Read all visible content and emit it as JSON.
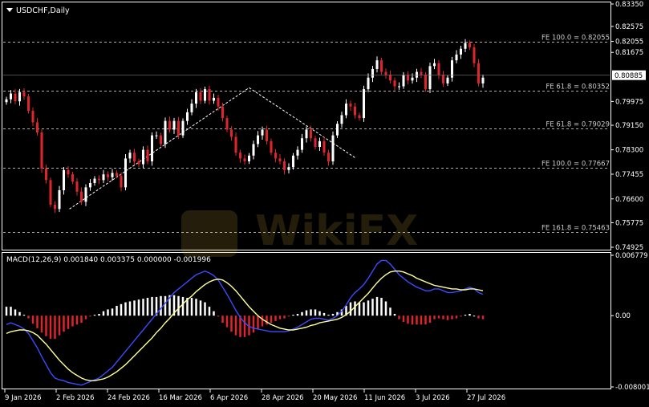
{
  "window": {
    "symbol_label": "USDCHF,Daily",
    "macd_label": "MACD(12,26,9) 0.001840 0.003375 0.000000 -0.001996",
    "watermark": "WikiFX"
  },
  "colors": {
    "background": "#000000",
    "frame": "#ffffff",
    "bull_candle": "#ffffff",
    "bear_candle": "#e0242e",
    "fib_line": "#cfcfcf",
    "macd_main": "#3b4bff",
    "macd_signal": "#ffff9a",
    "hist_pos": "#ffffff",
    "hist_neg": "#e0242e",
    "current_price_box": "#ffffff"
  },
  "chart_data": [
    {
      "type": "candlestick",
      "title": "USDCHF,Daily",
      "ylim": [
        0.74925,
        0.8335
      ],
      "price_scale": [
        "0.83350",
        "0.82575",
        "0.82055",
        "0.81675",
        "0.80885",
        "0.79975",
        "0.79150",
        "0.78300",
        "0.77455",
        "0.76600",
        "0.75775",
        "0.74925"
      ],
      "current_price": "0.80885",
      "fibo_levels": [
        {
          "label": "FE 100.0 = 0.82055",
          "value": 0.82055
        },
        {
          "label": "FE 61.8 = 0.80352",
          "value": 0.80352
        },
        {
          "label": "FE 61.8 = 0.79029",
          "value": 0.79029
        },
        {
          "label": "FE 100.0 = 0.77667",
          "value": 0.77667
        },
        {
          "label": "FE 161.8 = 0.75463",
          "value": 0.75463
        }
      ],
      "trend_points": [
        {
          "date": "2026-01-29",
          "price": 0.7625
        },
        {
          "date": "2026-03-27",
          "price": 0.8045
        },
        {
          "date": "2026-04-30",
          "price": 0.78
        }
      ],
      "x_labels": [
        "9 Jan 2026",
        "2 Feb 2026",
        "24 Feb 2026",
        "16 Mar 2026",
        "6 Apr 2026",
        "28 Apr 2026",
        "20 May 2026",
        "11 Jun 2026",
        "3 Jul 2026",
        "27 Jul 2026"
      ],
      "closes": [
        0.8005,
        0.8025,
        0.7998,
        0.803,
        0.8015,
        0.7965,
        0.7925,
        0.789,
        0.7765,
        0.7725,
        0.764,
        0.7625,
        0.769,
        0.776,
        0.7745,
        0.772,
        0.7685,
        0.765,
        0.77,
        0.7715,
        0.773,
        0.7725,
        0.7745,
        0.7735,
        0.775,
        0.774,
        0.77,
        0.78,
        0.782,
        0.779,
        0.778,
        0.783,
        0.779,
        0.788,
        0.788,
        0.785,
        0.793,
        0.79,
        0.793,
        0.788,
        0.793,
        0.796,
        0.799,
        0.803,
        0.8,
        0.804,
        0.8,
        0.801,
        0.798,
        0.794,
        0.79,
        0.7875,
        0.782,
        0.78,
        0.779,
        0.781,
        0.785,
        0.788,
        0.79,
        0.786,
        0.782,
        0.78,
        0.779,
        0.776,
        0.777,
        0.781,
        0.783,
        0.787,
        0.79,
        0.787,
        0.784,
        0.786,
        0.782,
        0.779,
        0.788,
        0.792,
        0.795,
        0.799,
        0.798,
        0.795,
        0.794,
        0.804,
        0.808,
        0.811,
        0.814,
        0.81,
        0.809,
        0.807,
        0.805,
        0.805,
        0.809,
        0.807,
        0.808,
        0.81,
        0.809,
        0.804,
        0.812,
        0.813,
        0.809,
        0.806,
        0.808,
        0.814,
        0.816,
        0.818,
        0.82,
        0.8185,
        0.813,
        0.806,
        0.808
      ],
      "macd_main": [
        -0.001,
        -0.0008,
        -0.001,
        -0.0012,
        -0.0015,
        -0.002,
        -0.0028,
        -0.0036,
        -0.0046,
        -0.0055,
        -0.0064,
        -0.007,
        -0.0072,
        -0.0073,
        -0.0075,
        -0.0076,
        -0.0077,
        -0.0078,
        -0.0076,
        -0.0074,
        -0.0072,
        -0.007,
        -0.0066,
        -0.0062,
        -0.0058,
        -0.0052,
        -0.0046,
        -0.004,
        -0.0034,
        -0.0028,
        -0.0022,
        -0.0016,
        -0.001,
        -0.0004,
        0.0002,
        0.0008,
        0.0014,
        0.002,
        0.0026,
        0.003,
        0.0034,
        0.0038,
        0.0042,
        0.0046,
        0.0048,
        0.005,
        0.0048,
        0.0045,
        0.004,
        0.0032,
        0.0024,
        0.0015,
        0.0006,
        -0.0002,
        -0.0008,
        -0.0012,
        -0.0014,
        -0.0015,
        -0.0016,
        -0.0017,
        -0.0018,
        -0.0018,
        -0.0018,
        -0.0018,
        -0.0017,
        -0.0015,
        -0.0013,
        -0.001,
        -0.0007,
        -0.0004,
        -0.0003,
        -0.0003,
        -0.0004,
        -0.0005,
        -0.0003,
        0.0,
        0.0005,
        0.0012,
        0.002,
        0.0026,
        0.003,
        0.0035,
        0.0042,
        0.005,
        0.0058,
        0.0062,
        0.0062,
        0.0058,
        0.0052,
        0.0046,
        0.0042,
        0.0038,
        0.0035,
        0.0032,
        0.003,
        0.0028,
        0.0028,
        0.003,
        0.003,
        0.0028,
        0.0026,
        0.0026,
        0.0027,
        0.0028,
        0.003,
        0.0032,
        0.003,
        0.0026,
        0.0024
      ],
      "macd_signal": [
        -0.002,
        -0.0018,
        -0.0017,
        -0.0016,
        -0.0016,
        -0.0017,
        -0.0019,
        -0.0022,
        -0.0027,
        -0.0032,
        -0.0038,
        -0.0044,
        -0.005,
        -0.0055,
        -0.006,
        -0.0064,
        -0.0067,
        -0.007,
        -0.0072,
        -0.0073,
        -0.0073,
        -0.0072,
        -0.0071,
        -0.0069,
        -0.0066,
        -0.0063,
        -0.0059,
        -0.0055,
        -0.005,
        -0.0045,
        -0.004,
        -0.0035,
        -0.003,
        -0.0025,
        -0.0019,
        -0.0014,
        -0.0008,
        -0.0003,
        0.0003,
        0.0008,
        0.0013,
        0.0018,
        0.0022,
        0.0027,
        0.0031,
        0.0035,
        0.0038,
        0.004,
        0.0041,
        0.004,
        0.0037,
        0.0033,
        0.0028,
        0.0022,
        0.0016,
        0.001,
        0.0005,
        0.0,
        -0.0004,
        -0.0007,
        -0.001,
        -0.0012,
        -0.0014,
        -0.0015,
        -0.0016,
        -0.0016,
        -0.0015,
        -0.0014,
        -0.0013,
        -0.0011,
        -0.001,
        -0.0008,
        -0.0007,
        -0.0006,
        -0.0005,
        -0.0004,
        -0.0002,
        0.0001,
        0.0005,
        0.001,
        0.0015,
        0.002,
        0.0025,
        0.0031,
        0.0037,
        0.0042,
        0.0046,
        0.0049,
        0.005,
        0.005,
        0.0049,
        0.0047,
        0.0045,
        0.0042,
        0.004,
        0.0038,
        0.0036,
        0.0034,
        0.0033,
        0.0032,
        0.0031,
        0.003,
        0.003,
        0.0029,
        0.0029,
        0.003,
        0.003,
        0.0029,
        0.0028
      ],
      "macd_ylim": [
        -0.008001,
        0.006779
      ],
      "macd_scale": [
        "0.006779",
        "0.00",
        "-0.008001"
      ]
    }
  ]
}
